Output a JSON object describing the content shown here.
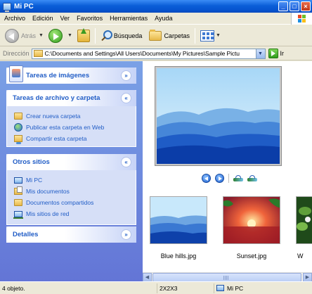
{
  "window": {
    "title": "Mi PC"
  },
  "menu": [
    "Archivo",
    "Edición",
    "Ver",
    "Favoritos",
    "Herramientas",
    "Ayuda"
  ],
  "toolbar": {
    "back": "Atrás",
    "search": "Búsqueda",
    "folders": "Carpetas"
  },
  "address": {
    "label": "Dirección",
    "path": "C:\\Documents and Settings\\All Users\\Documents\\My Pictures\\Sample Pictu",
    "go": "Ir"
  },
  "taskpane": {
    "image_tasks": {
      "title": "Tareas de imágenes"
    },
    "file_tasks": {
      "title": "Tareas de archivo y carpeta",
      "items": [
        "Crear nueva carpeta",
        "Publicar esta carpeta en Web",
        "Compartir esta carpeta"
      ]
    },
    "other_places": {
      "title": "Otros sitios",
      "items": [
        "Mi PC",
        "Mis documentos",
        "Documentos compartidos",
        "Mis sitios de red"
      ]
    },
    "details": {
      "title": "Detalles"
    }
  },
  "thumbnails": [
    "Blue hills.jpg",
    "Sunset.jpg",
    "W"
  ],
  "status": {
    "objects": "4 objeto.",
    "dimensions": "2X2X3",
    "location": "Mi PC"
  }
}
